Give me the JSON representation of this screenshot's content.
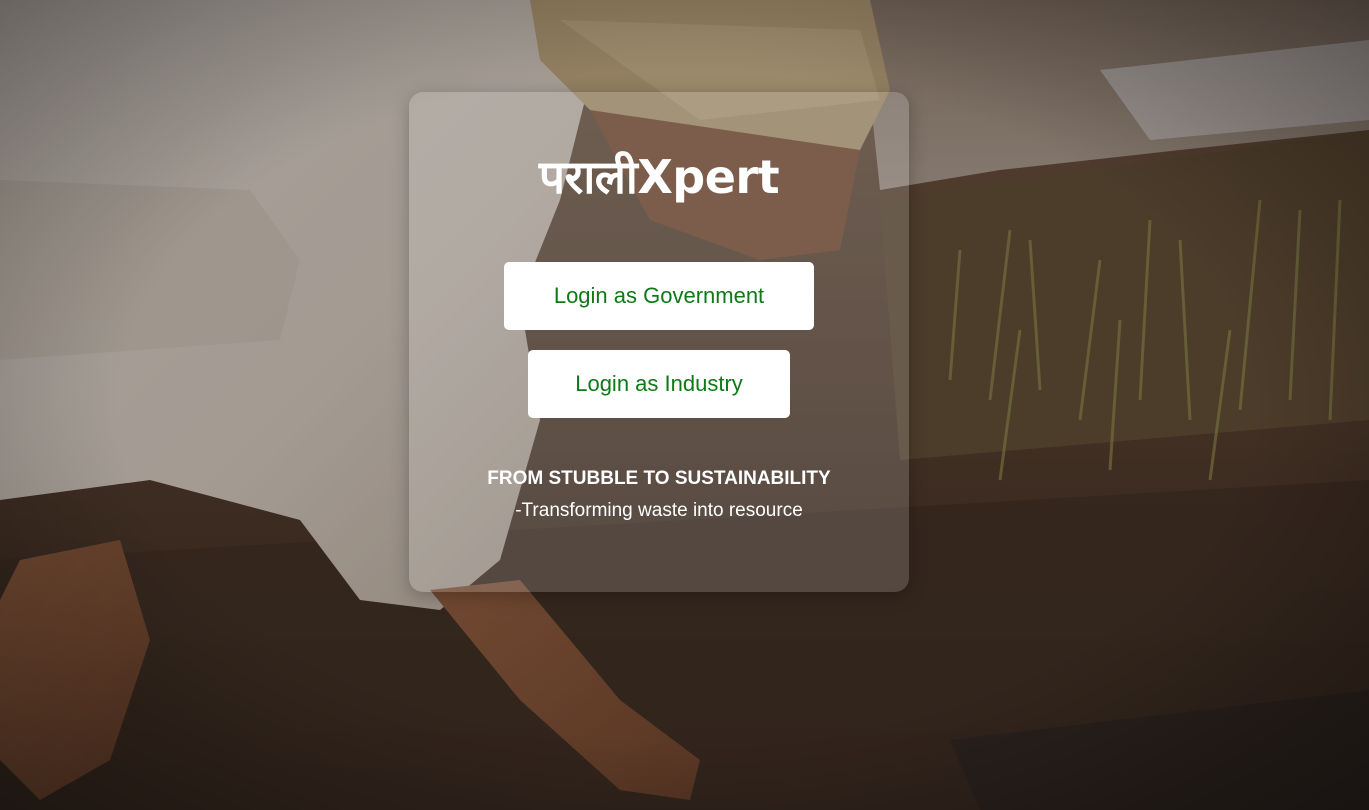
{
  "brand": {
    "title": "पराली",
    "title_suffix": "Xpert"
  },
  "buttons": {
    "government": "Login as Government",
    "industry": "Login as Industry"
  },
  "tagline": {
    "headline": "FROM STUBBLE TO SUSTAINABILITY",
    "subline": "-Transforming waste into resource"
  },
  "colors": {
    "button_text": "#0d7a17",
    "button_bg": "#ffffff",
    "text": "#ffffff"
  },
  "background": {
    "description_icon": "farmer-field-photo"
  }
}
